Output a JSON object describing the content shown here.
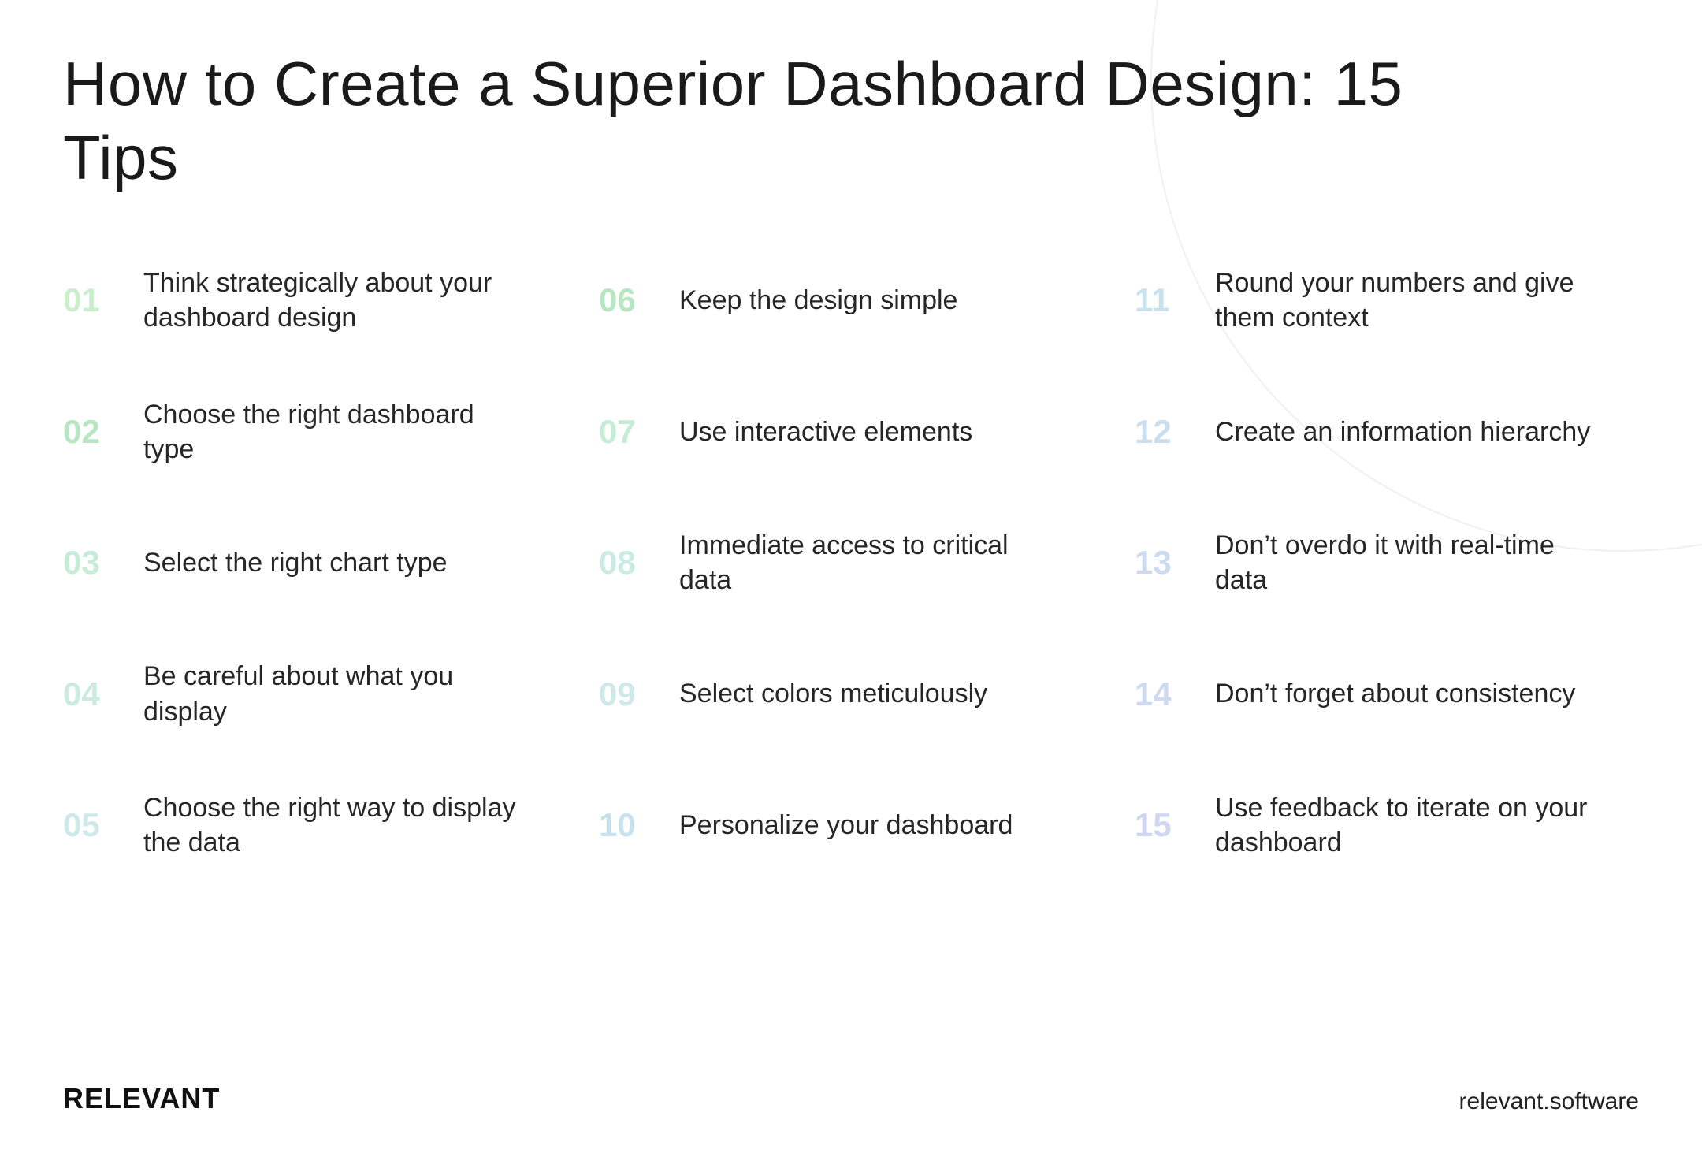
{
  "title": "How to Create a Superior Dashboard Design: 15 Tips",
  "tips": [
    {
      "num": "01",
      "text": "Think strategically about your dashboard design",
      "colorClass": "c-green"
    },
    {
      "num": "02",
      "text": "Choose the right dashboard type",
      "colorClass": "c-darkgreen"
    },
    {
      "num": "03",
      "text": "Select the right chart type",
      "colorClass": "c-mint"
    },
    {
      "num": "04",
      "text": "Be careful about what you display",
      "colorClass": "c-teal"
    },
    {
      "num": "05",
      "text": "Choose the right way to display the data",
      "colorClass": "c-skylight"
    },
    {
      "num": "06",
      "text": "Keep the design simple",
      "colorClass": "c-darkgreen"
    },
    {
      "num": "07",
      "text": "Use interactive elements",
      "colorClass": "c-mint"
    },
    {
      "num": "08",
      "text": "Immediate access to critical data",
      "colorClass": "c-teal"
    },
    {
      "num": "09",
      "text": "Select colors meticulously",
      "colorClass": "c-skylight"
    },
    {
      "num": "10",
      "text": "Personalize your dashboard",
      "colorClass": "c-sky"
    },
    {
      "num": "11",
      "text": "Round your numbers and give them context",
      "colorClass": "c-sky"
    },
    {
      "num": "12",
      "text": "Create an information hierarchy",
      "colorClass": "c-paleblue"
    },
    {
      "num": "13",
      "text": "Don’t overdo it with real-time data",
      "colorClass": "c-blue"
    },
    {
      "num": "14",
      "text": "Don’t forget about consistency",
      "colorClass": "c-softblue"
    },
    {
      "num": "15",
      "text": "Use feedback to iterate on your dashboard",
      "colorClass": "c-periwinkle"
    }
  ],
  "footer": {
    "brand": "RELEVANT",
    "site": "relevant.software"
  }
}
